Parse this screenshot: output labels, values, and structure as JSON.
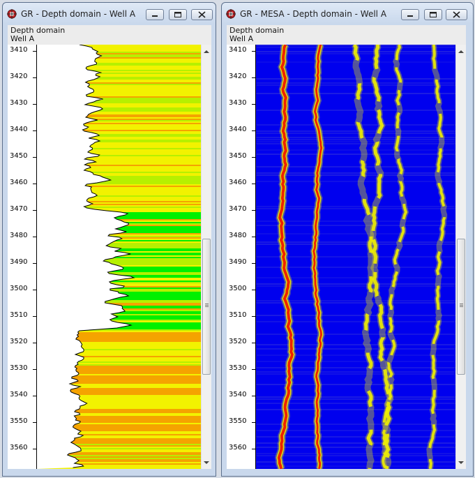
{
  "windows": [
    {
      "title": "GR - Depth domain - Well A",
      "header_line1": "Depth domain",
      "header_line2": "Well A"
    },
    {
      "title": "GR - MESA - Depth domain - Well A",
      "header_line1": "Depth domain",
      "header_line2": "Well A"
    }
  ],
  "depth_axis": {
    "ticks": [
      "3410",
      "3420",
      "3430",
      "3440",
      "3450",
      "3460",
      "3470",
      "3480",
      "3490",
      "3500",
      "3510",
      "3520",
      "3530",
      "3540",
      "3550",
      "3560"
    ],
    "range": [
      3410,
      3570
    ]
  },
  "icons": {
    "app": "gr-app-icon",
    "minimize": "minimize-icon",
    "maximize": "maximize-icon",
    "close": "close-icon",
    "scroll_up": "scroll-up-arrow-icon",
    "scroll_down": "scroll-down-arrow-icon"
  },
  "colors": {
    "gr_orange": "#f5a300",
    "gr_yellow": "#f2f200",
    "gr_lightgreen": "#b6f000",
    "gr_green": "#00f000",
    "mesa_background": "#0000ee",
    "mesa_peak_yellow": "#f0f000",
    "mesa_peak_red": "#ee2200"
  }
}
